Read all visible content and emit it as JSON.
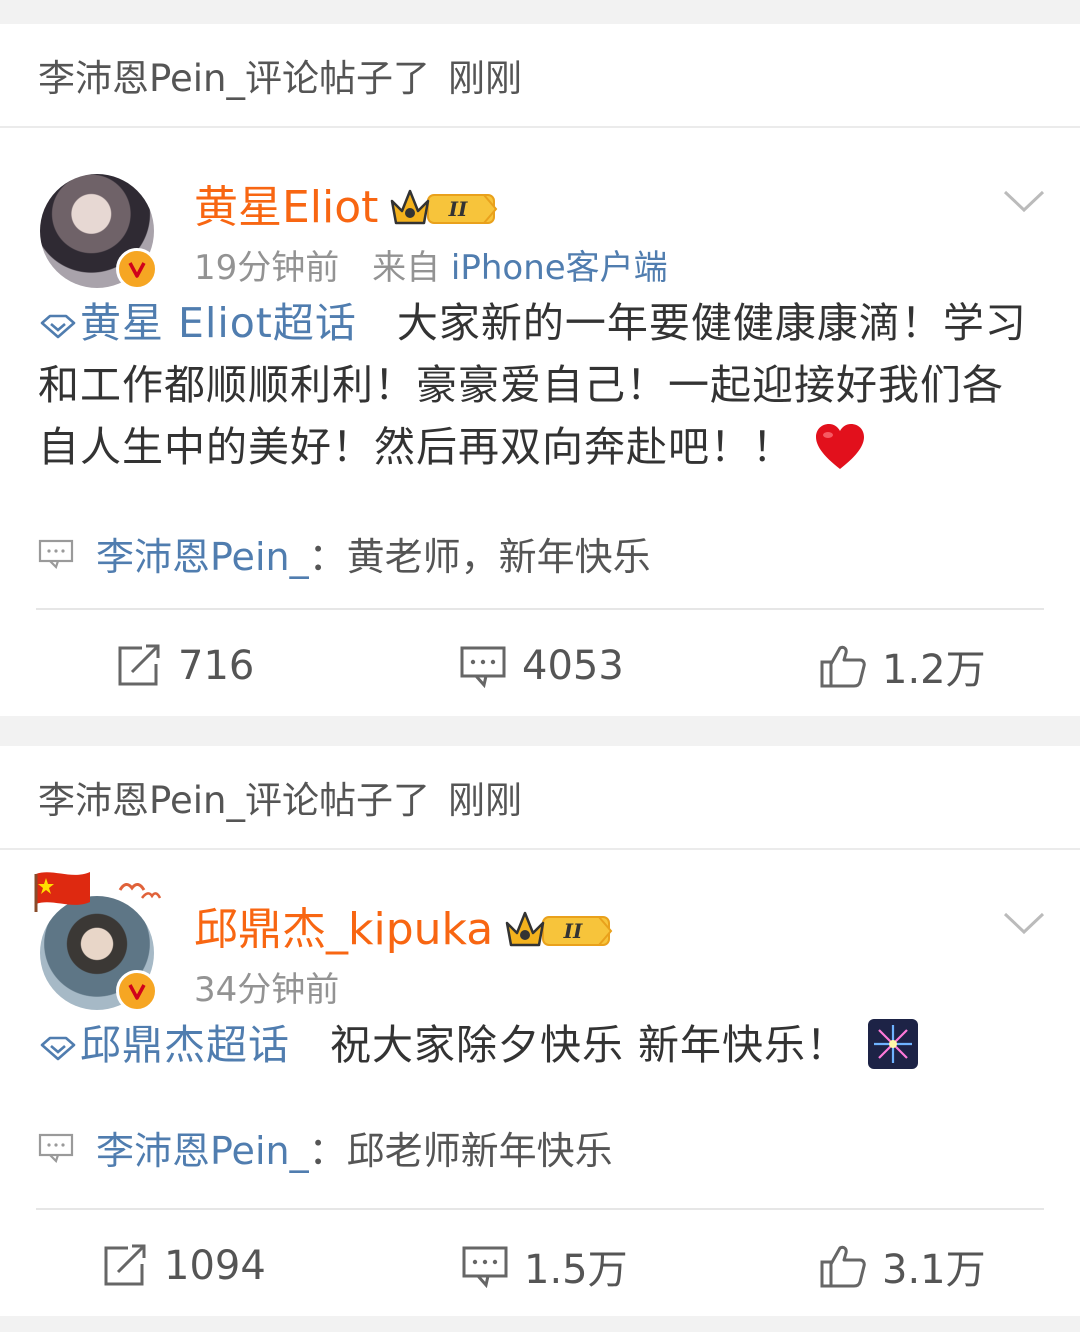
{
  "posts": [
    {
      "activity_text": "李沛恩Pein_评论帖子了",
      "activity_time": "刚刚",
      "username": "黄星Eliot",
      "level": "II",
      "time": "19分钟前",
      "source_label": "来自",
      "source": "iPhone客户端",
      "topic": "黄星 Eliot超话",
      "body": "大家新的一年要健健康康滴！学习和工作都顺顺利利！豪豪爱自己！一起迎接好我们各自人生中的美好！然后再双向奔赴吧！！",
      "emoji": "red-heart-icon",
      "comment_user": "李沛恩Pein_",
      "comment_text": "：黄老师，新年快乐",
      "reposts": "716",
      "comments": "4053",
      "likes": "1.2万"
    },
    {
      "activity_text": "李沛恩Pein_评论帖子了",
      "activity_time": "刚刚",
      "username": "邱鼎杰_kipuka",
      "level": "II",
      "time": "34分钟前",
      "topic": "邱鼎杰超话",
      "body": "祝大家除夕快乐 新年快乐！",
      "emoji": "fireworks-icon",
      "comment_user": "李沛恩Pein_",
      "comment_text": "：邱老师新年快乐",
      "reposts": "1094",
      "comments": "1.5万",
      "likes": "3.1万"
    }
  ],
  "colors": {
    "username": "#f86612",
    "link": "#507daf",
    "meta": "#939393",
    "background": "#f2f2f2"
  }
}
